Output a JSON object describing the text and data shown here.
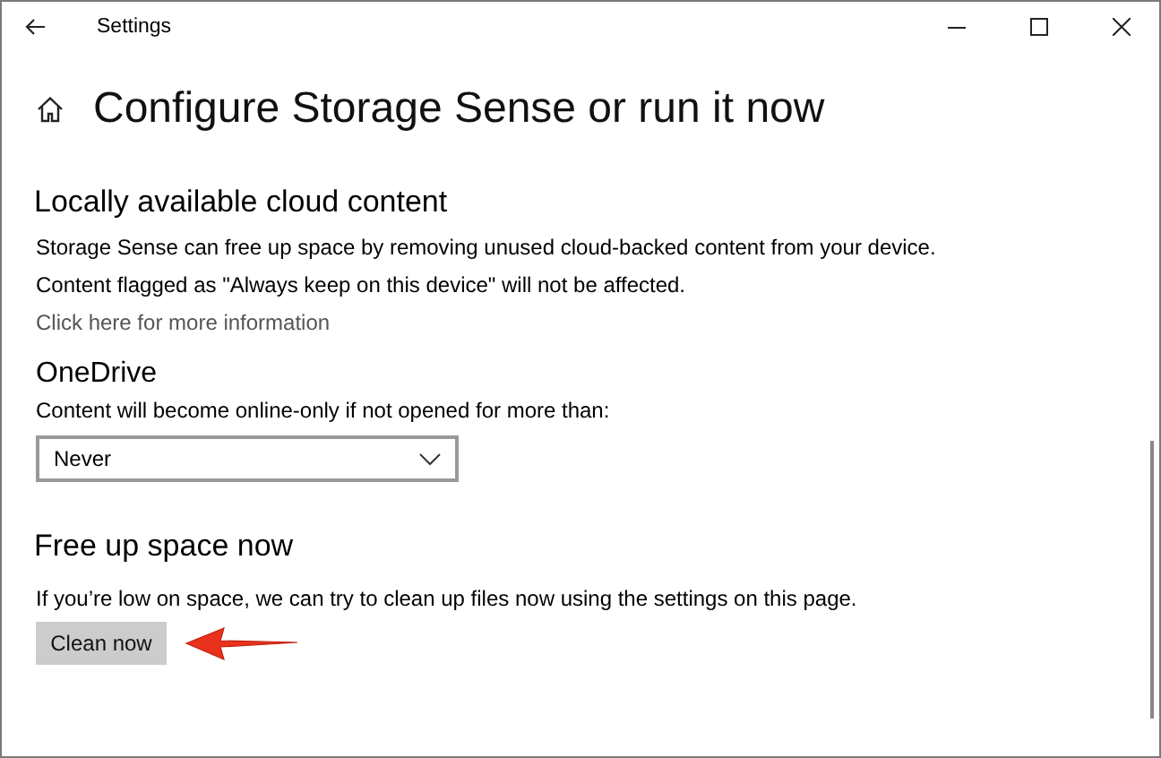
{
  "window": {
    "title": "Settings"
  },
  "page_title": "Configure Storage Sense or run it now",
  "sections": [
    {
      "heading": "Locally available cloud content",
      "paragraphs": [
        "Storage Sense can free up space by removing unused cloud-backed content from your device.",
        "Content flagged as \"Always keep on this device\" will not be affected."
      ],
      "link": "Click here for more information"
    },
    {
      "subheading": "OneDrive",
      "caption": "Content will become online-only if not opened for more than:",
      "dropdown": {
        "value": "Never"
      }
    },
    {
      "heading": "Free up space now",
      "paragraphs": [
        "If you’re low on space, we can try to clean up files now using the settings on this page."
      ],
      "button": "Clean now"
    }
  ]
}
